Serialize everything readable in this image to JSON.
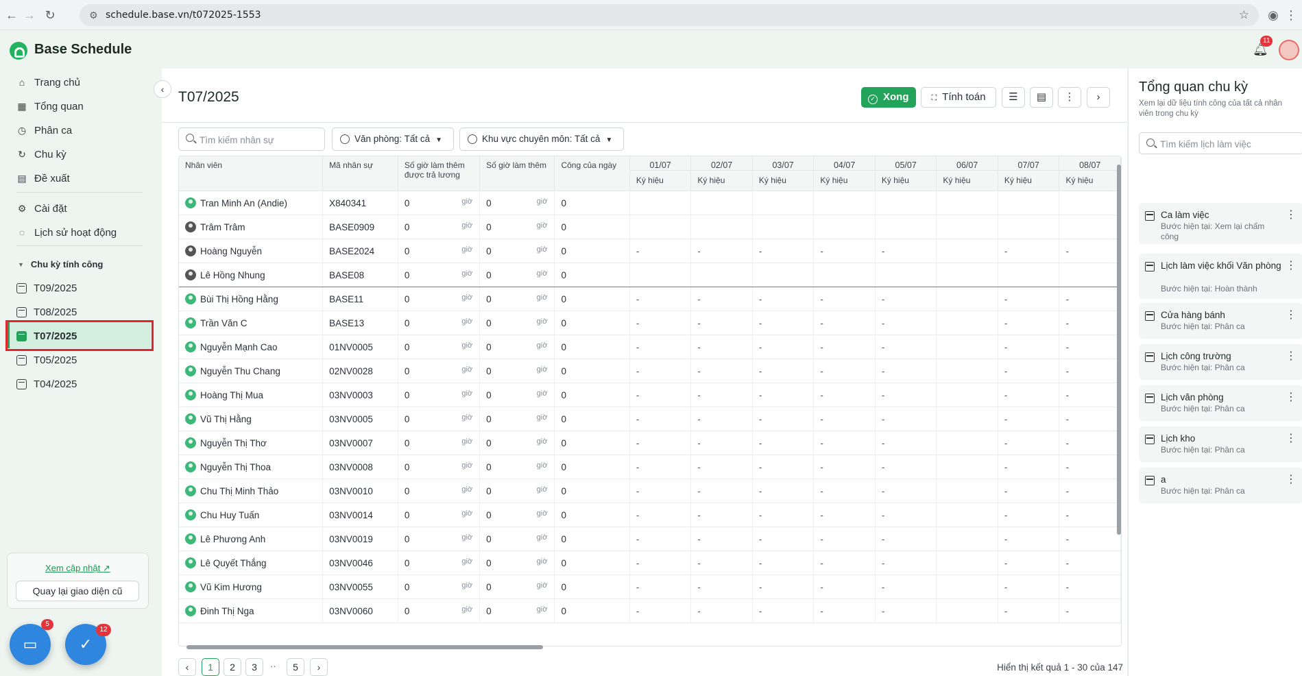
{
  "browser": {
    "url": "schedule.base.vn/t072025-1553"
  },
  "app": {
    "title": "Base Schedule",
    "notif_count": "11"
  },
  "sidebar": {
    "items": [
      {
        "label": "Trang chủ"
      },
      {
        "label": "Tổng quan"
      },
      {
        "label": "Phân ca"
      },
      {
        "label": "Chu kỳ"
      },
      {
        "label": "Đề xuất"
      },
      {
        "label": "Cài đặt"
      },
      {
        "label": "Lịch sử hoạt động"
      }
    ],
    "group_label": "Chu kỳ tính công",
    "cycles": [
      {
        "label": "T09/2025"
      },
      {
        "label": "T08/2025"
      },
      {
        "label": "T07/2025"
      },
      {
        "label": "T05/2025"
      },
      {
        "label": "T04/2025"
      }
    ],
    "update_link": "Xem cập nhật",
    "back_button": "Quay lại giao diện cũ",
    "chat_badge": "5",
    "task_badge": "12"
  },
  "main": {
    "title": "T07/2025",
    "done_button": "Xong",
    "calc_button": "Tính toán",
    "search_placeholder": "Tìm kiếm nhân sự",
    "filter_office": "Văn phòng: Tất cả",
    "filter_area": "Khu vực chuyên môn: Tất cả",
    "columns": {
      "employee": "Nhân viên",
      "code": "Mã nhân sự",
      "ot_paid": "Số giờ làm thêm được trả lương",
      "ot": "Số giờ làm thêm",
      "day_work": "Công của ngày"
    },
    "days": [
      "01/07",
      "02/07",
      "03/07",
      "04/07",
      "05/07",
      "06/07",
      "07/07",
      "08/07"
    ],
    "symbol_label": "Ký hiệu",
    "hour_unit": "giờ",
    "rows": [
      {
        "name": "Tran Minh An (Andie)",
        "code": "X840341",
        "ot_paid": "0",
        "ot": "0",
        "work": "0",
        "dash": false
      },
      {
        "name": "Trâm Trâm",
        "code": "BASE0909",
        "ot_paid": "0",
        "ot": "0",
        "work": "0",
        "dash": false
      },
      {
        "name": "Hoàng Nguyễn",
        "code": "BASE2024",
        "ot_paid": "0",
        "ot": "0",
        "work": "0",
        "dash": true
      },
      {
        "name": "Lê Hồng Nhung",
        "code": "BASE08",
        "ot_paid": "0",
        "ot": "0",
        "work": "0",
        "dash": false
      },
      {
        "name": "Bùi Thị Hồng Hằng",
        "code": "BASE11",
        "ot_paid": "0",
        "ot": "0",
        "work": "0",
        "dash": true
      },
      {
        "name": "Trần Văn C",
        "code": "BASE13",
        "ot_paid": "0",
        "ot": "0",
        "work": "0",
        "dash": true
      },
      {
        "name": "Nguyễn Mạnh Cao",
        "code": "01NV0005",
        "ot_paid": "0",
        "ot": "0",
        "work": "0",
        "dash": true
      },
      {
        "name": "Nguyễn Thu Chang",
        "code": "02NV0028",
        "ot_paid": "0",
        "ot": "0",
        "work": "0",
        "dash": true
      },
      {
        "name": "Hoàng Thị Mua",
        "code": "03NV0003",
        "ot_paid": "0",
        "ot": "0",
        "work": "0",
        "dash": true
      },
      {
        "name": "Vũ Thị Hằng",
        "code": "03NV0005",
        "ot_paid": "0",
        "ot": "0",
        "work": "0",
        "dash": true
      },
      {
        "name": "Nguyễn Thị Thơ",
        "code": "03NV0007",
        "ot_paid": "0",
        "ot": "0",
        "work": "0",
        "dash": true
      },
      {
        "name": "Nguyễn Thị Thoa",
        "code": "03NV0008",
        "ot_paid": "0",
        "ot": "0",
        "work": "0",
        "dash": true
      },
      {
        "name": "Chu Thị Minh Thảo",
        "code": "03NV0010",
        "ot_paid": "0",
        "ot": "0",
        "work": "0",
        "dash": true
      },
      {
        "name": "Chu Huy Tuấn",
        "code": "03NV0014",
        "ot_paid": "0",
        "ot": "0",
        "work": "0",
        "dash": true
      },
      {
        "name": "Lê Phương Anh",
        "code": "03NV0019",
        "ot_paid": "0",
        "ot": "0",
        "work": "0",
        "dash": true
      },
      {
        "name": "Lê Quyết Thắng",
        "code": "03NV0046",
        "ot_paid": "0",
        "ot": "0",
        "work": "0",
        "dash": true
      },
      {
        "name": "Vũ Kim Hương",
        "code": "03NV0055",
        "ot_paid": "0",
        "ot": "0",
        "work": "0",
        "dash": true
      },
      {
        "name": "Đinh Thị Nga",
        "code": "03NV0060",
        "ot_paid": "0",
        "ot": "0",
        "work": "0",
        "dash": true
      }
    ],
    "pagination": [
      "1",
      "2",
      "3",
      "5"
    ],
    "pagination_dots": "··",
    "result_text": "Hiển thị kết quả 1 - 30 của 147"
  },
  "right": {
    "title": "Tổng quan chu kỳ",
    "subtitle": "Xem lại dữ liệu tính công của tất cả nhân viên trong chu kỳ",
    "search_placeholder": "Tìm kiếm lịch làm việc",
    "cards": [
      {
        "title": "Ca làm việc",
        "step": "Bước hiện tại: Xem lại chấm công"
      },
      {
        "title": "Lịch làm việc khối Văn phòng",
        "step": "Bước hiện tại: Hoàn thành"
      },
      {
        "title": "Cửa hàng bánh",
        "step": "Bước hiện tại: Phân ca"
      },
      {
        "title": "Lịch công trường",
        "step": "Bước hiện tại: Phân ca"
      },
      {
        "title": "Lịch văn phòng",
        "step": "Bước hiện tại: Phân ca"
      },
      {
        "title": "Lịch kho",
        "step": "Bước hiện tại: Phân ca"
      },
      {
        "title": "a",
        "step": "Bước hiện tại: Phân ca"
      }
    ]
  }
}
